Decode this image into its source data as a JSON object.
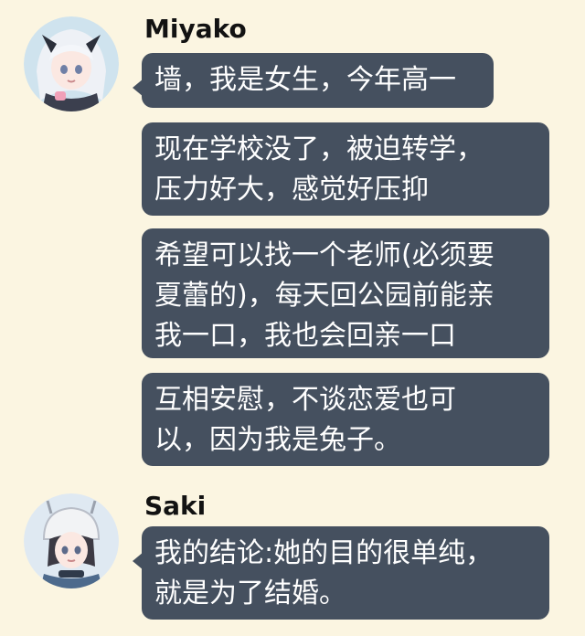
{
  "messages": [
    {
      "sender": "Miyako",
      "avatar_icon": "miyako-avatar-icon",
      "bubbles": [
        [
          "墙，我是女生，今年高一"
        ],
        [
          "现在学校没了，被迫转学，",
          "压力好大，感觉好压抑"
        ],
        [
          "希望可以找一个老师(必须要",
          "夏蕾的)，每天回公园前能亲",
          "我一口，我也会回亲一口"
        ],
        [
          "互相安慰，不谈恋爱也可",
          "以，因为我是兔子。"
        ]
      ]
    },
    {
      "sender": "Saki",
      "avatar_icon": "saki-avatar-icon",
      "bubbles": [
        [
          "我的结论:她的目的很单纯，",
          "就是为了结婚。"
        ]
      ]
    }
  ],
  "colors": {
    "background": "#fbf5e1",
    "bubble": "#45505f",
    "bubble_text": "#ffffff",
    "sender_text": "#121212"
  }
}
